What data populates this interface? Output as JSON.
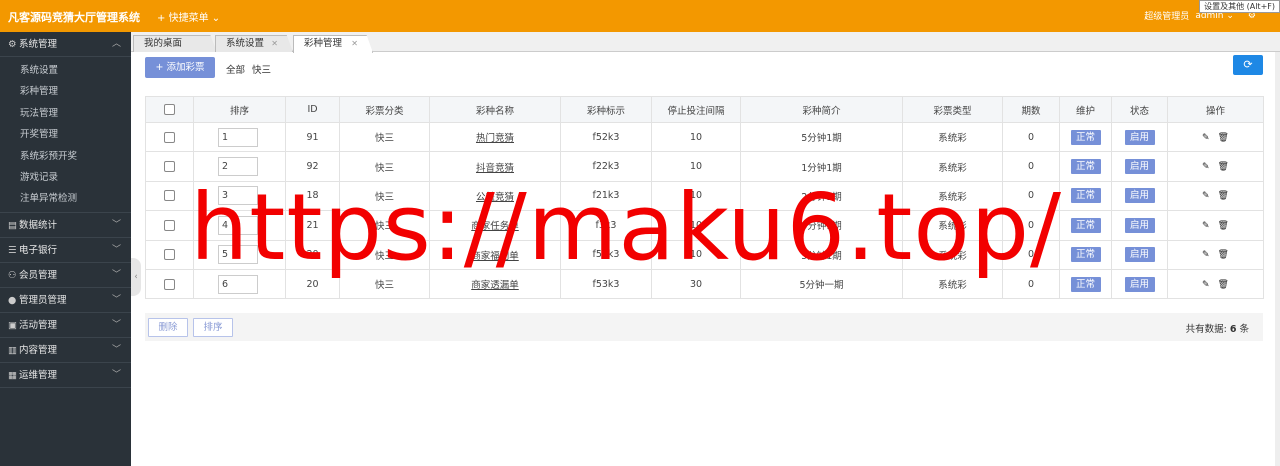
{
  "header": {
    "brand": "凡客源码竞猜大厅管理系统",
    "quick_menu": "快捷菜单",
    "role": "超级管理员",
    "user": "admin",
    "tooltip": "设置及其他 (Alt+F)"
  },
  "sidebar": {
    "groups": [
      {
        "label": "系统管理",
        "icon": "gear-icon",
        "expanded": true,
        "items": [
          "系统设置",
          "彩种管理",
          "玩法管理",
          "开奖管理",
          "系统彩预开奖",
          "游戏记录",
          "注单异常检测"
        ]
      },
      {
        "label": "数据统计",
        "icon": "chart-icon"
      },
      {
        "label": "电子银行",
        "icon": "bank-icon"
      },
      {
        "label": "会员管理",
        "icon": "users-icon"
      },
      {
        "label": "管理员管理",
        "icon": "admin-icon"
      },
      {
        "label": "活动管理",
        "icon": "gift-icon"
      },
      {
        "label": "内容管理",
        "icon": "content-icon"
      },
      {
        "label": "运维管理",
        "icon": "ops-icon"
      }
    ]
  },
  "tabs": [
    {
      "label": "我的桌面"
    },
    {
      "label": "系统设置"
    },
    {
      "label": "彩种管理"
    }
  ],
  "toolbar": {
    "add_label": "添加彩票",
    "filter_all": "全部",
    "filter_k3": "快三"
  },
  "table": {
    "headers": [
      "排序",
      "ID",
      "彩票分类",
      "彩种名称",
      "彩种标示",
      "停止投注间隔",
      "彩种简介",
      "彩票类型",
      "期数",
      "维护",
      "状态",
      "操作"
    ],
    "rows": [
      {
        "sort": "1",
        "id": "91",
        "cat": "快三",
        "name": "热门竞猜",
        "code": "f52k3",
        "stop": "10",
        "intro": "5分钟1期",
        "type": "系统彩",
        "issues": "0",
        "maint": "正常",
        "status": "启用"
      },
      {
        "sort": "2",
        "id": "92",
        "cat": "快三",
        "name": "抖音竞猜",
        "code": "f22k3",
        "stop": "10",
        "intro": "1分钟1期",
        "type": "系统彩",
        "issues": "0",
        "maint": "正常",
        "status": "启用"
      },
      {
        "sort": "3",
        "id": "18",
        "cat": "快三",
        "name": "公益竞猜",
        "code": "f21k3",
        "stop": "10",
        "intro": "2分钟1期",
        "type": "系统彩",
        "issues": "0",
        "maint": "正常",
        "status": "启用"
      },
      {
        "sort": "4",
        "id": "21",
        "cat": "快三",
        "name": "商家任务单",
        "code": "f3k3",
        "stop": "10",
        "intro": "3分钟1期",
        "type": "系统彩",
        "issues": "0",
        "maint": "正常",
        "status": "启用"
      },
      {
        "sort": "5",
        "id": "20",
        "cat": "快三",
        "name": "商家福利单",
        "code": "f51k3",
        "stop": "10",
        "intro": "5分钟1期",
        "type": "系统彩",
        "issues": "0",
        "maint": "正常",
        "status": "启用"
      },
      {
        "sort": "6",
        "id": "20",
        "cat": "快三",
        "name": "商家透漏单",
        "code": "f53k3",
        "stop": "30",
        "intro": "5分钟一期",
        "type": "系统彩",
        "issues": "0",
        "maint": "正常",
        "status": "启用"
      }
    ]
  },
  "footer": {
    "delete_label": "删除",
    "sort_label": "排序",
    "total_prefix": "共有数据:",
    "total_count": "6",
    "total_suffix": "条"
  },
  "watermark": "https://maku6.top/",
  "colors": {
    "topbar": "#f39800",
    "sidebar": "#2a3239",
    "accent": "#7690d8",
    "refresh": "#1e88e5",
    "watermark": "#f20000"
  }
}
